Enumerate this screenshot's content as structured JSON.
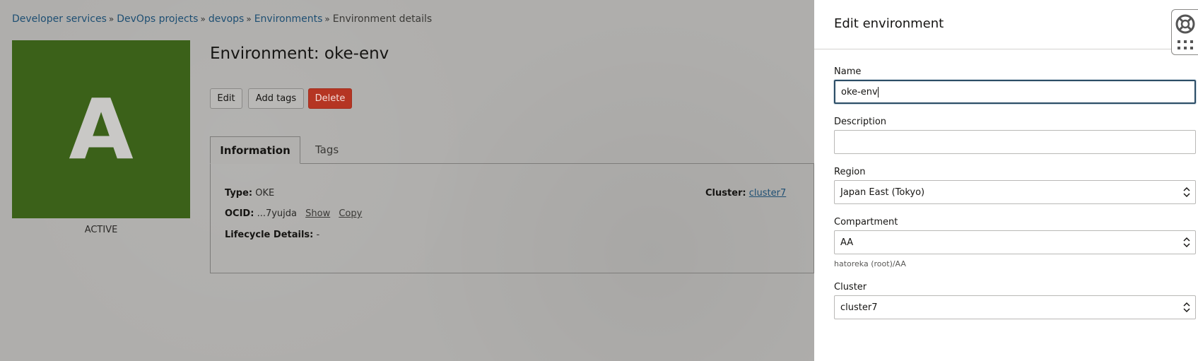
{
  "breadcrumb": {
    "items": [
      "Developer services",
      "DevOps projects",
      "devops",
      "Environments"
    ],
    "current": "Environment details"
  },
  "avatar": {
    "letter": "A",
    "color": "#3b6119",
    "status": "ACTIVE"
  },
  "page": {
    "title": "Environment: oke-env"
  },
  "actions": {
    "edit": "Edit",
    "add_tags": "Add tags",
    "delete": "Delete"
  },
  "tabs": [
    {
      "label": "Information",
      "active": true
    },
    {
      "label": "Tags",
      "active": false
    }
  ],
  "info": {
    "type_label": "Type:",
    "type_value": "OKE",
    "ocid_label": "OCID:",
    "ocid_value": "...7yujda",
    "show": "Show",
    "copy": "Copy",
    "lifecycle_label": "Lifecycle Details:",
    "lifecycle_value": "-",
    "cluster_label": "Cluster:",
    "cluster_value": "cluster7"
  },
  "drawer": {
    "title": "Edit environment",
    "name_label": "Name",
    "name_value": "oke-env",
    "description_label": "Description",
    "description_value": "",
    "region_label": "Region",
    "region_value": "Japan East (Tokyo)",
    "compartment_label": "Compartment",
    "compartment_value": "AA",
    "compartment_hint": "hatoreka (root)/AA",
    "cluster_label": "Cluster",
    "cluster_value": "cluster7"
  },
  "widget": {
    "icons": [
      "lifebuoy-icon",
      "grid-icon"
    ]
  },
  "colors": {
    "danger": "#b53523",
    "link": "#1e4f73",
    "focus": "#2c4d66"
  }
}
